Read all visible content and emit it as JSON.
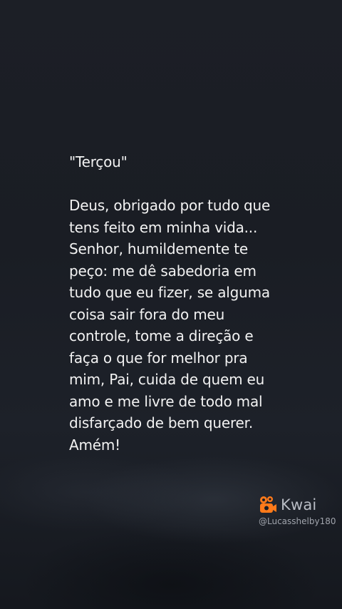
{
  "post": {
    "title": "\"Terçou\"",
    "lines": [
      "Deus, obrigado por tudo que",
      "tens feito em minha vida...",
      "Senhor, humildemente te",
      "peço: me dê sabedoria em",
      "tudo que eu fizer, se alguma",
      "coisa sair fora do meu",
      "controle, tome a direção e",
      "faça o que for melhor pra",
      "mim, Pai, cuida de quem eu",
      "amo e me livre de todo mal",
      "disfarçado de bem querer.",
      "Amém!"
    ]
  },
  "watermark": {
    "brand": "Kwai",
    "icon": "kwai-logo-icon",
    "handle": "@Lucasshelby180",
    "color": "#ff7a1a"
  }
}
